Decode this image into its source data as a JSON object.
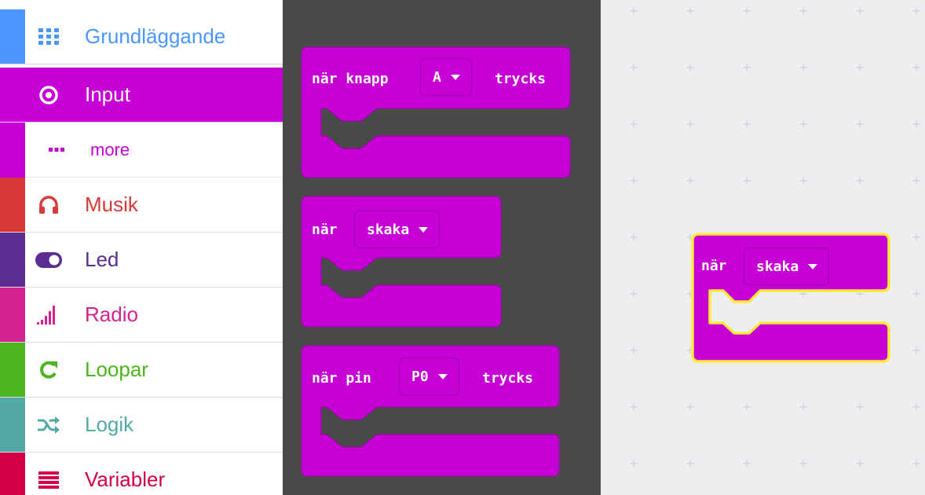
{
  "toolbox": {
    "categories": [
      {
        "label": "Grundläggande",
        "icon": "grid-icon",
        "color": "#4c97ff"
      },
      {
        "label": "Input",
        "icon": "target-icon",
        "color": "#c700d6",
        "selected": true
      },
      {
        "label": "more",
        "icon": "more-dots-icon",
        "color": "#c700d6",
        "subcategory": true
      },
      {
        "label": "Musik",
        "icon": "headphones-icon",
        "color": "#d83b37"
      },
      {
        "label": "Led",
        "icon": "toggle-icon",
        "color": "#5c2d91"
      },
      {
        "label": "Radio",
        "icon": "signal-bars-icon",
        "color": "#d5228f"
      },
      {
        "label": "Loopar",
        "icon": "refresh-icon",
        "color": "#4ab51c"
      },
      {
        "label": "Logik",
        "icon": "shuffle-icon",
        "color": "#53a9a6"
      },
      {
        "label": "Variabler",
        "icon": "list-lines-icon",
        "color": "#d4004a"
      }
    ]
  },
  "flyout": {
    "blocks": [
      {
        "prefix": "när knapp",
        "dropdown": "A",
        "suffix": "trycks"
      },
      {
        "prefix": "när",
        "dropdown": "skaka",
        "suffix": ""
      },
      {
        "prefix": "när pin",
        "dropdown": "P0",
        "suffix": "trycks"
      }
    ]
  },
  "workspace": {
    "block": {
      "prefix": "när",
      "dropdown": "skaka",
      "selected": true
    }
  },
  "colors": {
    "block": "#c700d6",
    "block_border": "#9d00aa",
    "selection": "#ffeb3b",
    "flyout_bg": "#4a4a4a",
    "workspace_bg": "#eceef0"
  }
}
